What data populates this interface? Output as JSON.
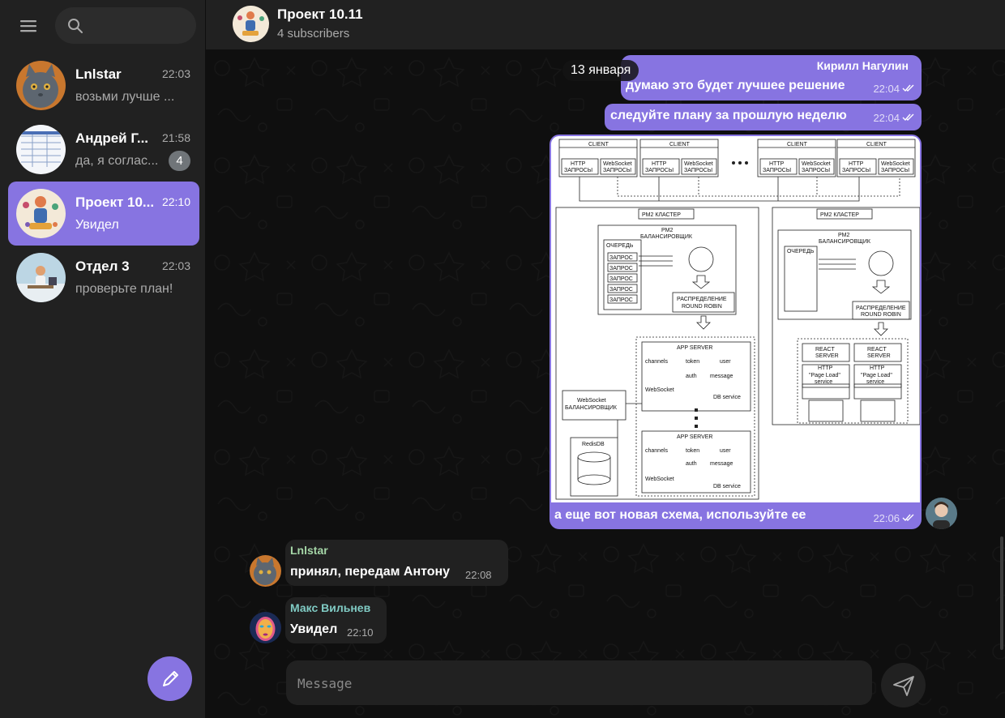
{
  "sidebar": {
    "search_placeholder": "",
    "chats": [
      {
        "name": "Lnlstar",
        "time": "22:03",
        "preview": "возьми лучше ..."
      },
      {
        "name": "Андрей Г...",
        "time": "21:58",
        "preview": "да, я соглас...",
        "unread": "4"
      },
      {
        "name": "Проект 10...",
        "time": "22:10",
        "preview": "Увидел"
      },
      {
        "name": "Отдел 3",
        "time": "22:03",
        "preview": "проверьте план!"
      }
    ]
  },
  "header": {
    "title": "Проект 10.11",
    "subtitle": "4 subscribers"
  },
  "chat": {
    "date_chip": "13 января",
    "messages": [
      {
        "sender": "Кирилл Нагулин",
        "text": "думаю это будет лучшее решение",
        "time": "22:04"
      },
      {
        "text": "следуйте плану за прошлую неделю",
        "time": "22:04"
      },
      {
        "text": "а еще вот новая схема, используйте ее",
        "time": "22:06"
      },
      {
        "sender": "Lnlstar",
        "text": "принял, передам Антону",
        "time": "22:08"
      },
      {
        "sender": "Макс Вильнев",
        "text": "Увидел",
        "time": "22:10"
      }
    ],
    "diagram": {
      "client": "CLIENT",
      "http": [
        "HTTP",
        "ЗАПРОСЫ"
      ],
      "websocket": [
        "WebSocket",
        "ЗАПРОСЫ"
      ],
      "pm2": "PM2 КЛАСТЕР",
      "balancer": [
        "PM2",
        "БАЛАНСИРОВЩИК"
      ],
      "queue": "ОЧЕРЕДЬ",
      "request": "ЗАПРОС",
      "distribution": [
        "РАСПРЕДЕЛЕНИЕ",
        "ROUND ROBIN"
      ],
      "app_server": "APP SERVER",
      "services": [
        "channels",
        "token",
        "user",
        "auth",
        "message"
      ],
      "service_word": "service",
      "ws_service": "WebSocket",
      "db_service": "DB service",
      "ws_balancer": [
        "WebSocket",
        "БАЛАНСИРОВЩИК"
      ],
      "redis": "RedisDB",
      "react": [
        "REACT",
        "SERVER"
      ],
      "page_load": [
        "HTTP",
        "\"Page Load\"",
        "service"
      ]
    }
  },
  "composer": {
    "placeholder": "Message"
  },
  "colors": {
    "accent": "#8774e1",
    "panel": "#212121",
    "background": "#0f0f0f",
    "sender_green": "#a5d6a7",
    "sender_teal": "#80cbc4"
  }
}
